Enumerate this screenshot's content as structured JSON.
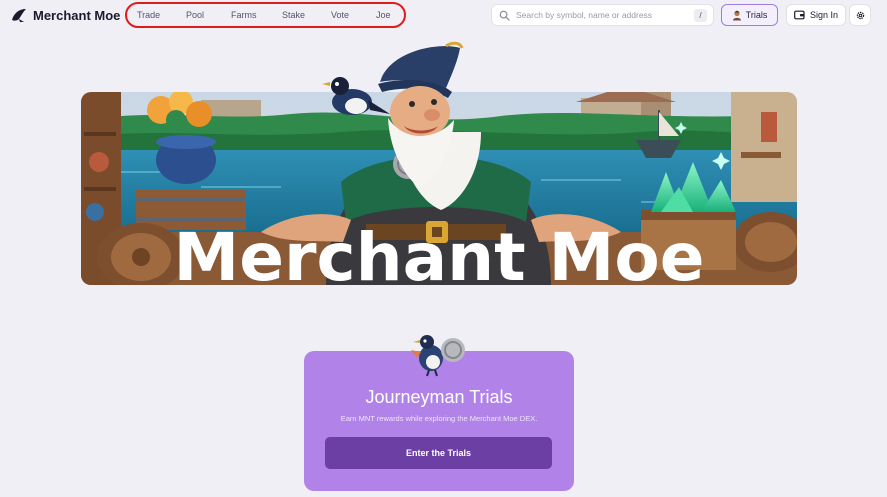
{
  "brand": {
    "name": "Merchant Moe"
  },
  "nav": {
    "items": [
      {
        "label": "Trade"
      },
      {
        "label": "Pool"
      },
      {
        "label": "Farms"
      },
      {
        "label": "Stake"
      },
      {
        "label": "Vote"
      },
      {
        "label": "Joe"
      }
    ]
  },
  "search": {
    "placeholder": "Search by symbol, name or address",
    "shortcut": "/"
  },
  "header_actions": {
    "trials_label": "Trials",
    "signin_label": "Sign In",
    "settings_icon": "gear-icon"
  },
  "hero": {
    "title": "Merchant Moe"
  },
  "trials_card": {
    "title": "Journeyman Trials",
    "subtitle": "Earn MNT rewards while exploring the Merchant Moe DEX.",
    "button_label": "Enter the Trials"
  },
  "colors": {
    "background": "#f0eff6",
    "accent_purple": "#b183e8",
    "button_purple": "#6b3fa4",
    "nav_highlight": "#e01b1b"
  }
}
